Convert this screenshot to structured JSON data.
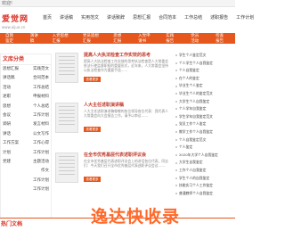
{
  "topbar": {
    "text": "欢迎!"
  },
  "logo": {
    "name": "爱觉网",
    "sub": "www.aijue.cn"
  },
  "mainnav": [
    "首页",
    "讲话稿",
    "实用范文",
    "讲话致辞",
    "思想汇报",
    "合同范本",
    "工作总结",
    "述职报告",
    "工作计划"
  ],
  "subnav": [
    "自我鉴定",
    "演讲稿",
    "入党思想汇报",
    "党员思想汇报",
    "思想汇报",
    "入党申请书",
    "实践报告",
    "党员活动",
    "检查报告"
  ],
  "categories": {
    "title": "文库分类",
    "rows": [
      [
        "思想汇报",
        "实践范文"
      ],
      [
        "讲话稿",
        "合同范本"
      ],
      [
        "活动",
        "工作总结"
      ],
      [
        "述职",
        "申报材料"
      ],
      [
        "思想",
        "个人总结"
      ],
      [
        "会议",
        "工作计划"
      ],
      [
        "调研",
        "发言材料"
      ],
      [
        "讲话",
        "公文写作"
      ],
      [
        "工作方案",
        "工作心得"
      ],
      [
        "计划",
        "工作计划"
      ],
      [
        "党建",
        "主题活动"
      ],
      [
        "",
        "作文"
      ],
      [
        "",
        "工作计划"
      ],
      [
        "",
        "工作计划"
      ]
    ]
  },
  "articles": [
    {
      "title": "提高人大执法检查工作实效的思考",
      "snippet": "提高人大执法检查工作实效的思考执法检查是人大常委会依法行使监督职权的重要形式，近年来，人大常委会坚持以执法检查作为重要手段……",
      "more": "查看更多"
    },
    {
      "title": "人大主任述职演讲稿",
      "snippet": "人大主任述职演讲稿尊敬的各位领导各位代表：我代表人大常委会向大会报告工作，请予以审议……",
      "more": "查看更多"
    },
    {
      "title": "在全市优秀基层代表述职评议会",
      "snippet": "在全市优秀基层代表述职评议会上的讲话各位代表，同志们：今天我们召开全市优秀基层代表述职评议会议……",
      "more": "查看更多"
    }
  ],
  "list": [
    "学生个人鉴定范文",
    "个人学生个人自我鉴定",
    "个人自我鉴定",
    "在个人的鉴定",
    "毕业生个人鉴定",
    "毕业生个人的鉴定范文",
    "大学生个人自我鉴定",
    "个人学年自我鉴定",
    "学生学年自我鉴定范文",
    "党员工作个人鉴定",
    "教学工作个人自我鉴定",
    "个人自我鉴定范文",
    "个人鉴定",
    "2020年大学个人自我鉴定",
    "大学生自我鉴定",
    "工作个人自我鉴定",
    "学生个人的自我鉴定",
    "技能实习个人工作鉴定",
    "普通教师个人自我鉴定"
  ],
  "hot": {
    "title": "热门文档"
  },
  "watermark": "逸达快收录"
}
